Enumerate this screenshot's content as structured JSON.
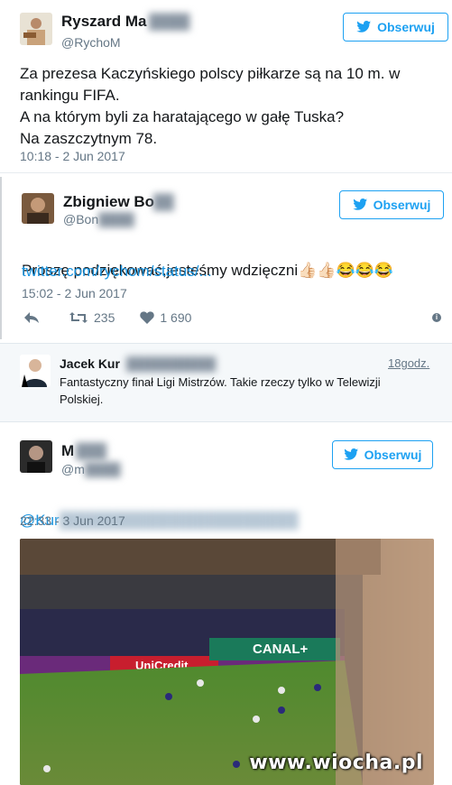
{
  "tweets": [
    {
      "name": "Ryszard Ma",
      "handle": "@RychoM",
      "follow_label": "Obserwuj",
      "text": "Za prezesa Kaczyńskiego polscy piłkarze są na 10 m. w\nrankingu FIFA.\nA na którym byli za haratającego w gałę Tuska?\nNa zaszczytnym 78.",
      "time": "10:18 - 2 Jun 2017"
    },
    {
      "name": "Zbigniew Bo",
      "handle": "@Bon",
      "follow_label": "Obserwuj",
      "text": "Proszę podziękować,jesteśmy wdzięczni",
      "emoji": "👍🏻👍🏻😂😂😂",
      "link": "twitter.com/rychom/status/...",
      "time": "15:02 - 2 Jun 2017",
      "retweets": "235",
      "likes": "1 690"
    },
    {
      "name": "Jacek Kur",
      "time_ago": "18godz.",
      "text": "Fantastyczny finał Ligi Mistrzów. Takie rzeczy tylko w Telewizji\nPolskiej."
    },
    {
      "name": "M",
      "handle": "@m",
      "follow_label": "Obserwuj",
      "mention": "@Kur",
      "time": "22:33 - 3 Jun 2017",
      "photo_text": {
        "sponsor1": "UniCredit",
        "sponsor2": "CANAL+"
      }
    }
  ],
  "watermark": "www.wiocha.pl",
  "colors": {
    "accent": "#1da1f2",
    "link": "#1b95e0",
    "muted": "#657786"
  }
}
